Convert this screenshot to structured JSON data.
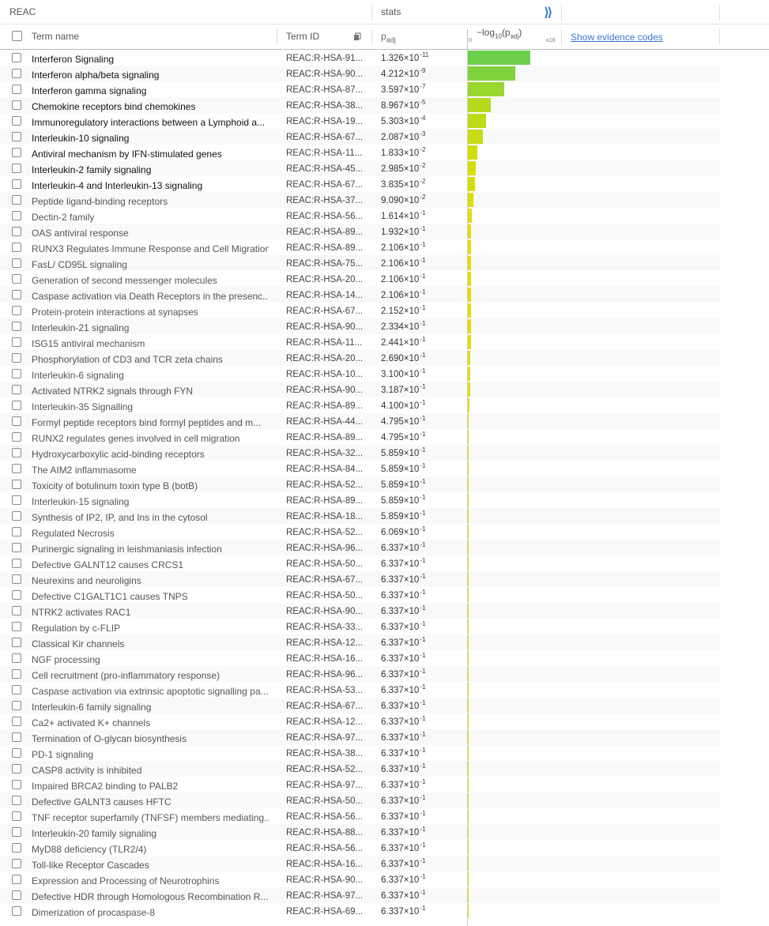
{
  "header": {
    "source": "REAC",
    "stats": "stats",
    "expand_glyph": "⟫",
    "col_term_name": "Term name",
    "col_term_id": "Term ID",
    "col_padj_main": "p",
    "col_padj_sub": "adj",
    "axis_title_pre": "−log",
    "axis_title_base": "10",
    "axis_title_mid": "(p",
    "axis_title_sub": "adj",
    "axis_title_post": ")",
    "axis_tick_min": "0",
    "axis_tick_max": "≤16",
    "show_evidence": "Show evidence codes"
  },
  "colors": {
    "link": "#3a78d4",
    "bar_high": "#6cd04a",
    "bar_low": "#e8e000"
  },
  "chart_data": {
    "type": "bar",
    "axis": {
      "label": "−log10(padj)",
      "range": [
        0,
        16
      ],
      "tick_labels": [
        "0",
        "≤16"
      ]
    },
    "rows": [
      {
        "name": "Interferon Signaling",
        "id": "REAC:R-HSA-91...",
        "mant": "1.326",
        "exp": "-11",
        "sig": true
      },
      {
        "name": "Interferon alpha/beta signaling",
        "id": "REAC:R-HSA-90...",
        "mant": "4.212",
        "exp": "-9",
        "sig": true
      },
      {
        "name": "Interferon gamma signaling",
        "id": "REAC:R-HSA-87...",
        "mant": "3.597",
        "exp": "-7",
        "sig": true
      },
      {
        "name": "Chemokine receptors bind chemokines",
        "id": "REAC:R-HSA-38...",
        "mant": "8.967",
        "exp": "-5",
        "sig": true
      },
      {
        "name": "Immunoregulatory interactions between a Lymphoid a...",
        "id": "REAC:R-HSA-19...",
        "mant": "5.303",
        "exp": "-4",
        "sig": true
      },
      {
        "name": "Interleukin-10 signaling",
        "id": "REAC:R-HSA-67...",
        "mant": "2.087",
        "exp": "-3",
        "sig": true
      },
      {
        "name": "Antiviral mechanism by IFN-stimulated genes",
        "id": "REAC:R-HSA-11...",
        "mant": "1.833",
        "exp": "-2",
        "sig": true
      },
      {
        "name": "Interleukin-2 family signaling",
        "id": "REAC:R-HSA-45...",
        "mant": "2.985",
        "exp": "-2",
        "sig": true
      },
      {
        "name": "Interleukin-4 and Interleukin-13 signaling",
        "id": "REAC:R-HSA-67...",
        "mant": "3.835",
        "exp": "-2",
        "sig": true
      },
      {
        "name": "Peptide ligand-binding receptors",
        "id": "REAC:R-HSA-37...",
        "mant": "9.090",
        "exp": "-2",
        "sig": false
      },
      {
        "name": "Dectin-2 family",
        "id": "REAC:R-HSA-56...",
        "mant": "1.614",
        "exp": "-1",
        "sig": false
      },
      {
        "name": "OAS antiviral response",
        "id": "REAC:R-HSA-89...",
        "mant": "1.932",
        "exp": "-1",
        "sig": false
      },
      {
        "name": "RUNX3 Regulates Immune Response and Cell Migration",
        "id": "REAC:R-HSA-89...",
        "mant": "2.106",
        "exp": "-1",
        "sig": false
      },
      {
        "name": "FasL/ CD95L signaling",
        "id": "REAC:R-HSA-75...",
        "mant": "2.106",
        "exp": "-1",
        "sig": false
      },
      {
        "name": "Generation of second messenger molecules",
        "id": "REAC:R-HSA-20...",
        "mant": "2.106",
        "exp": "-1",
        "sig": false
      },
      {
        "name": "Caspase activation via Death Receptors in the presenc...",
        "id": "REAC:R-HSA-14...",
        "mant": "2.106",
        "exp": "-1",
        "sig": false
      },
      {
        "name": "Protein-protein interactions at synapses",
        "id": "REAC:R-HSA-67...",
        "mant": "2.152",
        "exp": "-1",
        "sig": false
      },
      {
        "name": "Interleukin-21 signaling",
        "id": "REAC:R-HSA-90...",
        "mant": "2.334",
        "exp": "-1",
        "sig": false
      },
      {
        "name": "ISG15 antiviral mechanism",
        "id": "REAC:R-HSA-11...",
        "mant": "2.441",
        "exp": "-1",
        "sig": false
      },
      {
        "name": "Phosphorylation of CD3 and TCR zeta chains",
        "id": "REAC:R-HSA-20...",
        "mant": "2.690",
        "exp": "-1",
        "sig": false
      },
      {
        "name": "Interleukin-6 signaling",
        "id": "REAC:R-HSA-10...",
        "mant": "3.100",
        "exp": "-1",
        "sig": false
      },
      {
        "name": "Activated NTRK2 signals through FYN",
        "id": "REAC:R-HSA-90...",
        "mant": "3.187",
        "exp": "-1",
        "sig": false
      },
      {
        "name": "Interleukin-35 Signalling",
        "id": "REAC:R-HSA-89...",
        "mant": "4.100",
        "exp": "-1",
        "sig": false
      },
      {
        "name": "Formyl peptide receptors bind formyl peptides and m...",
        "id": "REAC:R-HSA-44...",
        "mant": "4.795",
        "exp": "-1",
        "sig": false
      },
      {
        "name": "RUNX2 regulates genes involved in cell migration",
        "id": "REAC:R-HSA-89...",
        "mant": "4.795",
        "exp": "-1",
        "sig": false
      },
      {
        "name": "Hydroxycarboxylic acid-binding receptors",
        "id": "REAC:R-HSA-32...",
        "mant": "5.859",
        "exp": "-1",
        "sig": false
      },
      {
        "name": "The AIM2 inflammasome",
        "id": "REAC:R-HSA-84...",
        "mant": "5.859",
        "exp": "-1",
        "sig": false
      },
      {
        "name": "Toxicity of botulinum toxin type B (botB)",
        "id": "REAC:R-HSA-52...",
        "mant": "5.859",
        "exp": "-1",
        "sig": false
      },
      {
        "name": "Interleukin-15 signaling",
        "id": "REAC:R-HSA-89...",
        "mant": "5.859",
        "exp": "-1",
        "sig": false
      },
      {
        "name": "Synthesis of IP2, IP, and Ins in the cytosol",
        "id": "REAC:R-HSA-18...",
        "mant": "5.859",
        "exp": "-1",
        "sig": false
      },
      {
        "name": "Regulated Necrosis",
        "id": "REAC:R-HSA-52...",
        "mant": "6.069",
        "exp": "-1",
        "sig": false
      },
      {
        "name": "Purinergic signaling in leishmaniasis infection",
        "id": "REAC:R-HSA-96...",
        "mant": "6.337",
        "exp": "-1",
        "sig": false
      },
      {
        "name": "Defective GALNT12 causes CRCS1",
        "id": "REAC:R-HSA-50...",
        "mant": "6.337",
        "exp": "-1",
        "sig": false
      },
      {
        "name": "Neurexins and neuroligins",
        "id": "REAC:R-HSA-67...",
        "mant": "6.337",
        "exp": "-1",
        "sig": false
      },
      {
        "name": "Defective C1GALT1C1 causes TNPS",
        "id": "REAC:R-HSA-50...",
        "mant": "6.337",
        "exp": "-1",
        "sig": false
      },
      {
        "name": "NTRK2 activates RAC1",
        "id": "REAC:R-HSA-90...",
        "mant": "6.337",
        "exp": "-1",
        "sig": false
      },
      {
        "name": "Regulation by c-FLIP",
        "id": "REAC:R-HSA-33...",
        "mant": "6.337",
        "exp": "-1",
        "sig": false
      },
      {
        "name": "Classical Kir channels",
        "id": "REAC:R-HSA-12...",
        "mant": "6.337",
        "exp": "-1",
        "sig": false
      },
      {
        "name": "NGF processing",
        "id": "REAC:R-HSA-16...",
        "mant": "6.337",
        "exp": "-1",
        "sig": false
      },
      {
        "name": "Cell recruitment (pro-inflammatory response)",
        "id": "REAC:R-HSA-96...",
        "mant": "6.337",
        "exp": "-1",
        "sig": false
      },
      {
        "name": "Caspase activation via extrinsic apoptotic signalling pa...",
        "id": "REAC:R-HSA-53...",
        "mant": "6.337",
        "exp": "-1",
        "sig": false
      },
      {
        "name": "Interleukin-6 family signaling",
        "id": "REAC:R-HSA-67...",
        "mant": "6.337",
        "exp": "-1",
        "sig": false
      },
      {
        "name": "Ca2+ activated K+ channels",
        "id": "REAC:R-HSA-12...",
        "mant": "6.337",
        "exp": "-1",
        "sig": false
      },
      {
        "name": "Termination of O-glycan biosynthesis",
        "id": "REAC:R-HSA-97...",
        "mant": "6.337",
        "exp": "-1",
        "sig": false
      },
      {
        "name": "PD-1 signaling",
        "id": "REAC:R-HSA-38...",
        "mant": "6.337",
        "exp": "-1",
        "sig": false
      },
      {
        "name": "CASP8 activity is inhibited",
        "id": "REAC:R-HSA-52...",
        "mant": "6.337",
        "exp": "-1",
        "sig": false
      },
      {
        "name": "Impaired BRCA2 binding to PALB2",
        "id": "REAC:R-HSA-97...",
        "mant": "6.337",
        "exp": "-1",
        "sig": false
      },
      {
        "name": "Defective GALNT3 causes HFTC",
        "id": "REAC:R-HSA-50...",
        "mant": "6.337",
        "exp": "-1",
        "sig": false
      },
      {
        "name": "TNF receptor superfamily (TNFSF) members mediating...",
        "id": "REAC:R-HSA-56...",
        "mant": "6.337",
        "exp": "-1",
        "sig": false
      },
      {
        "name": "Interleukin-20 family signaling",
        "id": "REAC:R-HSA-88...",
        "mant": "6.337",
        "exp": "-1",
        "sig": false
      },
      {
        "name": "MyD88 deficiency (TLR2/4)",
        "id": "REAC:R-HSA-56...",
        "mant": "6.337",
        "exp": "-1",
        "sig": false
      },
      {
        "name": "Toll-like Receptor Cascades",
        "id": "REAC:R-HSA-16...",
        "mant": "6.337",
        "exp": "-1",
        "sig": false
      },
      {
        "name": "Expression and Processing of Neurotrophins",
        "id": "REAC:R-HSA-90...",
        "mant": "6.337",
        "exp": "-1",
        "sig": false
      },
      {
        "name": "Defective HDR through Homologous Recombination R...",
        "id": "REAC:R-HSA-97...",
        "mant": "6.337",
        "exp": "-1",
        "sig": false
      },
      {
        "name": "Dimerization of procaspase-8",
        "id": "REAC:R-HSA-69...",
        "mant": "6.337",
        "exp": "-1",
        "sig": false
      }
    ]
  }
}
